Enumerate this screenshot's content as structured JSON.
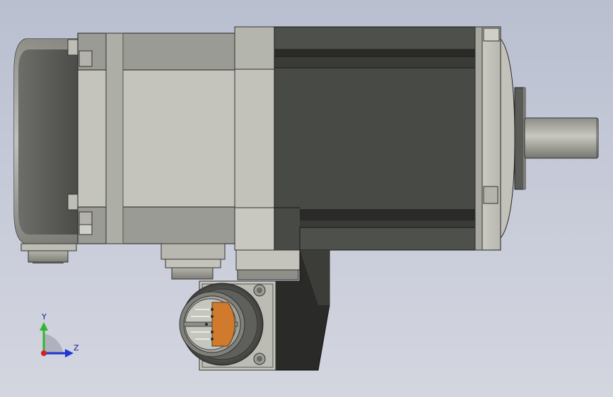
{
  "viewport": {
    "background_top": "#b9bfd0",
    "background_bottom": "#d3d6df"
  },
  "model": {
    "description_icons": [
      "servo-motor-model"
    ]
  },
  "triad": {
    "x_label": "",
    "y_label": "Y",
    "z_label": "Z",
    "y_color": "#2fb82f",
    "z_color": "#1f35d6",
    "x_color": "#d62020"
  }
}
